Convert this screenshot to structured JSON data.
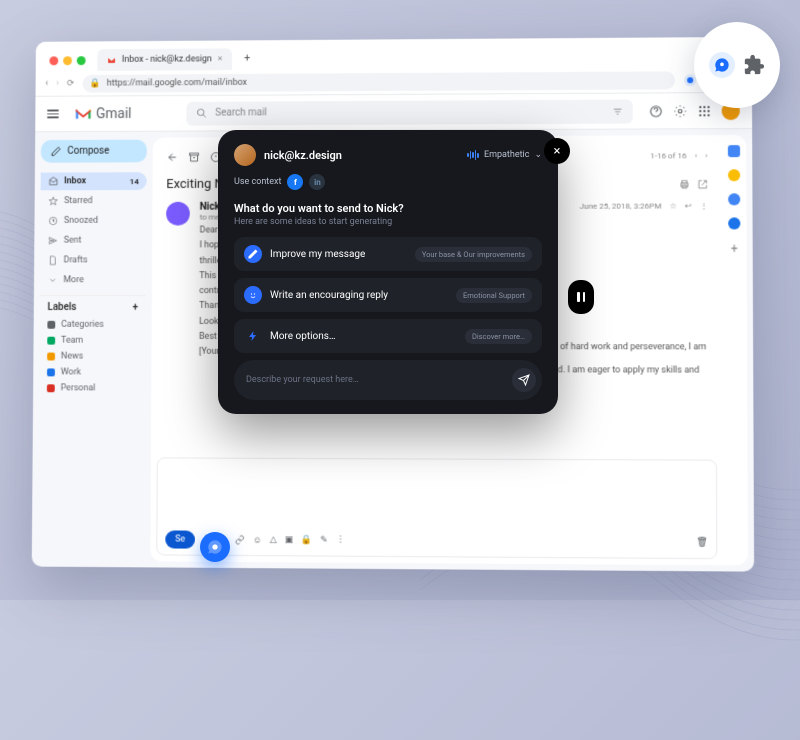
{
  "browser": {
    "tab_title": "Inbox - nick@kz.design",
    "url": "https://mail.google.com/mail/inbox"
  },
  "gmail": {
    "brand": "Gmail",
    "search_placeholder": "Search mail",
    "compose": "Compose",
    "nav": [
      {
        "icon": "inbox",
        "label": "Inbox",
        "count": "14",
        "active": true
      },
      {
        "icon": "star",
        "label": "Starred"
      },
      {
        "icon": "clock",
        "label": "Snoozed"
      },
      {
        "icon": "send",
        "label": "Sent"
      },
      {
        "icon": "file",
        "label": "Drafts"
      },
      {
        "icon": "chev",
        "label": "More"
      }
    ],
    "labels_header": "Labels",
    "labels": [
      {
        "color": "#5f6368",
        "label": "Categories"
      },
      {
        "color": "#00a862",
        "label": "Team"
      },
      {
        "color": "#f29900",
        "label": "News"
      },
      {
        "color": "#1a73e8",
        "label": "Work"
      },
      {
        "color": "#d93025",
        "label": "Personal"
      }
    ],
    "pager": "1-16 of 16",
    "subject": "Exciting N",
    "sender": "Nick Zhur",
    "sender_sub": "to me",
    "date": "June 25, 2018, 3:26PM",
    "body_lines": [
      "Dear John,",
      "I hope this",
      "thrilled to s",
      "This new p",
      "contributio",
      "Thank you",
      "Looking fo",
      "Best regar",
      "[Your Nam"
    ],
    "body_right_lines": [
      "b! After a lot of hard work and perseverance, I am",
      "that lie ahead. I am eager to apply my skills and"
    ],
    "compose_send": "Se"
  },
  "ai": {
    "email": "nick@kz.design",
    "tone": "Empathetic",
    "context_label": "Use context",
    "prompt": "What do you want to send to Nick?",
    "sub": "Here are some ideas to start generating",
    "options": [
      {
        "icon": "pencil",
        "bg": "#2b6cff",
        "label": "Improve my message",
        "pill": "Your base & Our improvements"
      },
      {
        "icon": "smile",
        "bg": "#2b6cff",
        "label": "Write an encouraging reply",
        "pill": "Emotional Support"
      },
      {
        "icon": "bolt",
        "bg": "transparent",
        "label": "More options…",
        "pill": "Discover more…"
      }
    ],
    "input_placeholder": "Describe your request here…"
  }
}
